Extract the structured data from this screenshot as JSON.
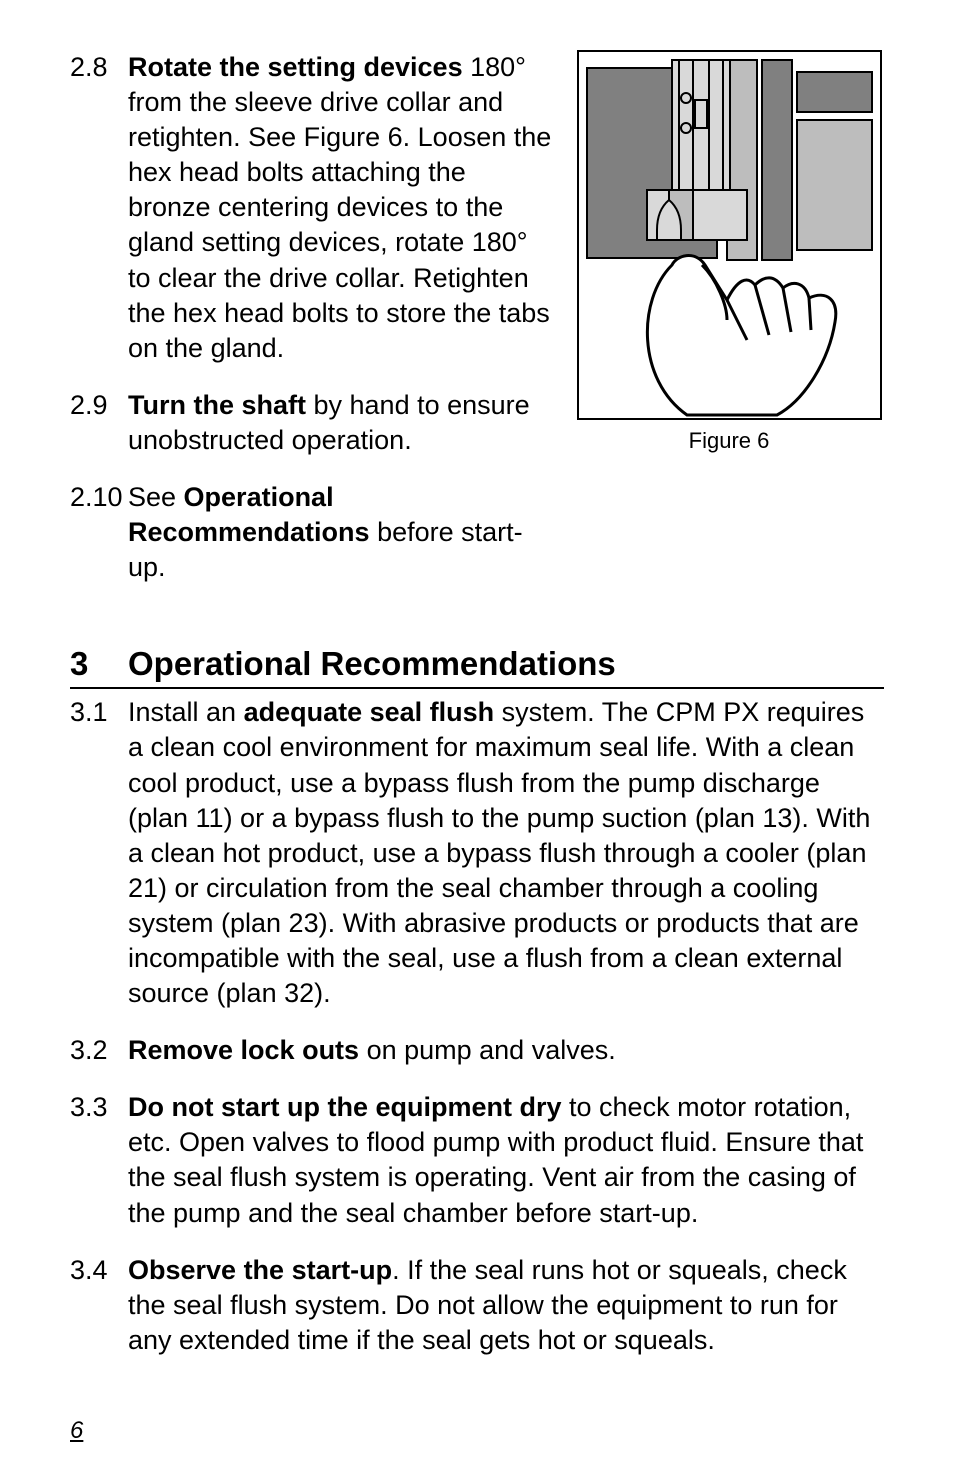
{
  "step28": {
    "num": "2.8",
    "lead": "Rotate the setting devices",
    "rest": " 180° from the sleeve drive collar and retighten. See Figure 6. Loosen the hex head bolts attaching the bronze centering devices to the gland setting devices, rotate 180° to clear the drive collar. Retighten the hex head bolts to store the tabs on the gland."
  },
  "step29": {
    "num": "2.9",
    "lead": "Turn the shaft",
    "rest": " by hand to ensure unobstructed operation."
  },
  "step210": {
    "num": "2.10",
    "pre": "See ",
    "lead": "Operational Recommendations",
    "rest": " before start-up."
  },
  "figure6_caption": "Figure 6",
  "section3": {
    "num": "3",
    "title": "Operational Recommendations"
  },
  "step31": {
    "num": "3.1",
    "pre": "Install an ",
    "lead": "adequate seal flush",
    "rest": " system. The CPM PX requires a clean cool environment for maximum seal life. With a clean cool product, use a bypass flush from the pump discharge (plan 11) or a bypass flush to the pump suction (plan 13). With a clean hot product, use a bypass flush through a cooler (plan 21) or circulation from the seal chamber through a cooling system (plan 23). With abrasive products or products that are incompatible with the seal, use a flush from a clean external source (plan 32)."
  },
  "step32": {
    "num": "3.2",
    "lead": "Remove lock outs",
    "rest": " on pump and valves."
  },
  "step33": {
    "num": "3.3",
    "lead": "Do not start up the equipment dry",
    "rest": " to check motor rotation, etc. Open valves to flood pump with product fluid. Ensure that the seal flush system is operating. Vent air from the casing of the pump and the seal chamber before start-up."
  },
  "step34": {
    "num": "3.4",
    "lead": "Observe the start-up",
    "rest": ". If the seal runs hot or squeals, check the seal flush system. Do not allow the equipment to run for any extended time if the seal gets hot or squeals."
  },
  "page_number": "6"
}
